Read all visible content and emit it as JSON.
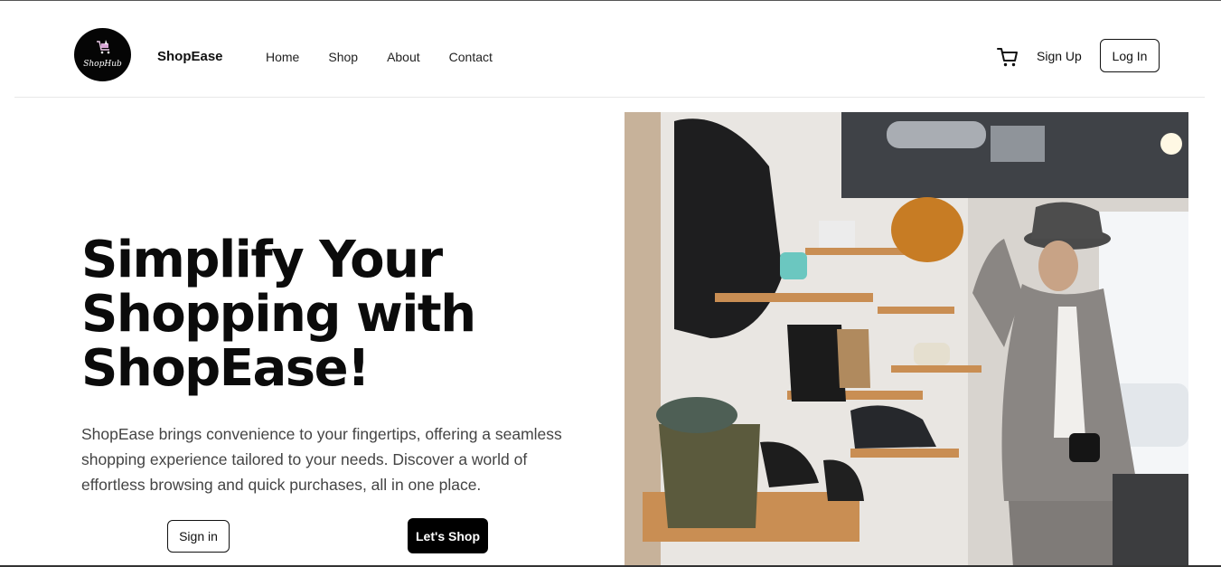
{
  "header": {
    "logo_text": "ShopHub",
    "brand": "ShopEase",
    "nav": [
      "Home",
      "Shop",
      "About",
      "Contact"
    ],
    "cart_icon": "shopping-cart-icon",
    "signup_label": "Sign Up",
    "login_label": "Log In"
  },
  "hero": {
    "title_line1": "Simplify Your",
    "title_line2": "Shopping with",
    "title_line3": "ShopEase!",
    "description": "ShopEase brings convenience to your fingertips, offering a seamless shopping experience tailored to your needs. Discover a world of effortless browsing and quick purchases, all in one place.",
    "signin_label": "Sign in",
    "shop_label": "Let's Shop"
  },
  "colors": {
    "accent": "#000000",
    "text": "#111111",
    "muted_text": "#444444"
  }
}
